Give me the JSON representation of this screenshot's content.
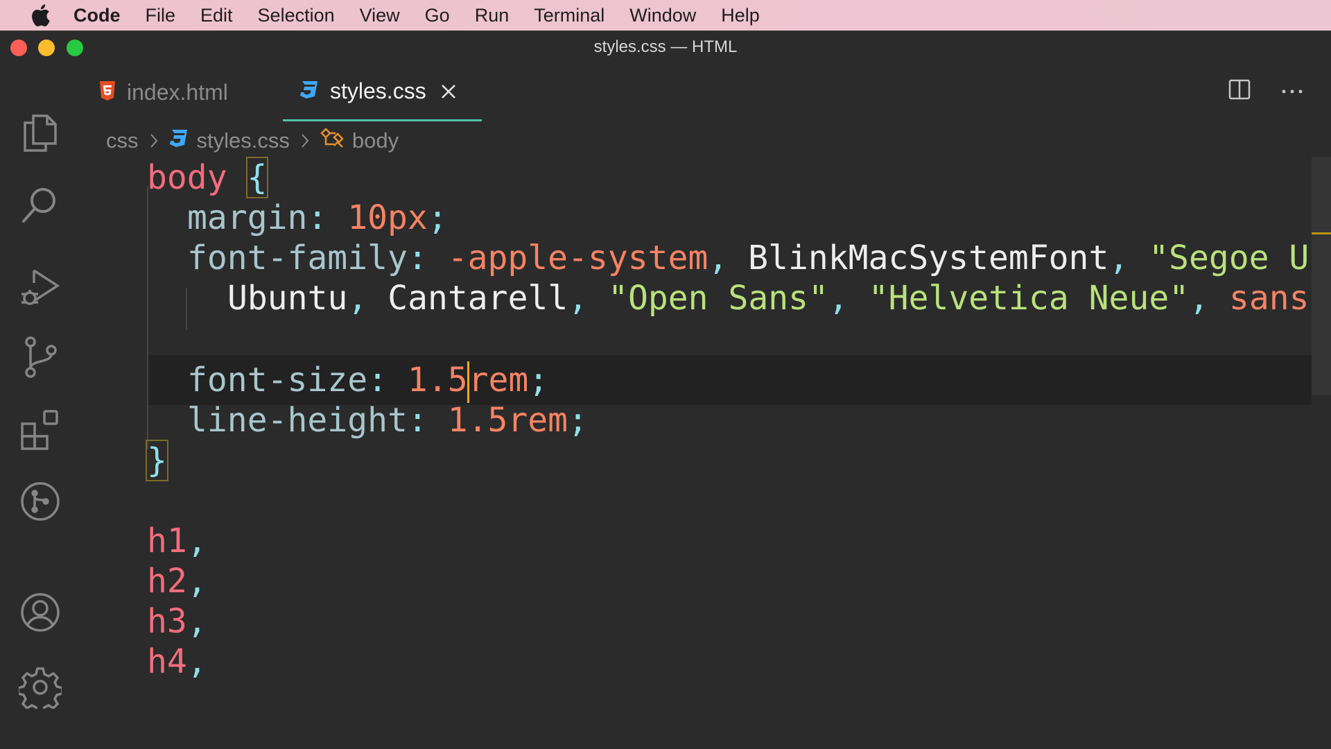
{
  "menubar": {
    "app": "Code",
    "items": [
      "File",
      "Edit",
      "Selection",
      "View",
      "Go",
      "Run",
      "Terminal",
      "Window",
      "Help"
    ]
  },
  "window": {
    "title": "styles.css — HTML"
  },
  "tabs": [
    {
      "label": "index.html",
      "icon": "html5-icon",
      "active": false
    },
    {
      "label": "styles.css",
      "icon": "css3-icon",
      "active": true
    }
  ],
  "breadcrumb": {
    "folder": "css",
    "file": "styles.css",
    "symbol": "body"
  },
  "editor": {
    "line1": {
      "sel": "body",
      "brace": "{"
    },
    "line2": {
      "prop": "margin",
      "value": "10px"
    },
    "line3": {
      "prop": "font-family",
      "v1": "-apple-system",
      "v2": "BlinkMacSystemFont",
      "v3": "\"Segoe UI"
    },
    "line4": {
      "v1": "Ubuntu",
      "v2": "Cantarell",
      "v3": "\"Open Sans\"",
      "v4": "\"Helvetica Neue\"",
      "v5": "sans-"
    },
    "line5": {
      "prop": "font-size",
      "value_before_cursor": "1.5",
      "value_after_cursor": "rem"
    },
    "line6": {
      "prop": "line-height",
      "value": "1.5rem"
    },
    "line7": {
      "brace": "}"
    },
    "line8": {
      "sel": "h1"
    },
    "line9": {
      "sel": "h2"
    },
    "line10": {
      "sel": "h3"
    },
    "line11": {
      "sel": "h4"
    }
  },
  "colors": {
    "accent_tab_underline": "#4fc3a9",
    "cursor": "#f0a71e",
    "selector": "#f26d7d",
    "number": "#f58363",
    "string": "#b9e27b"
  }
}
